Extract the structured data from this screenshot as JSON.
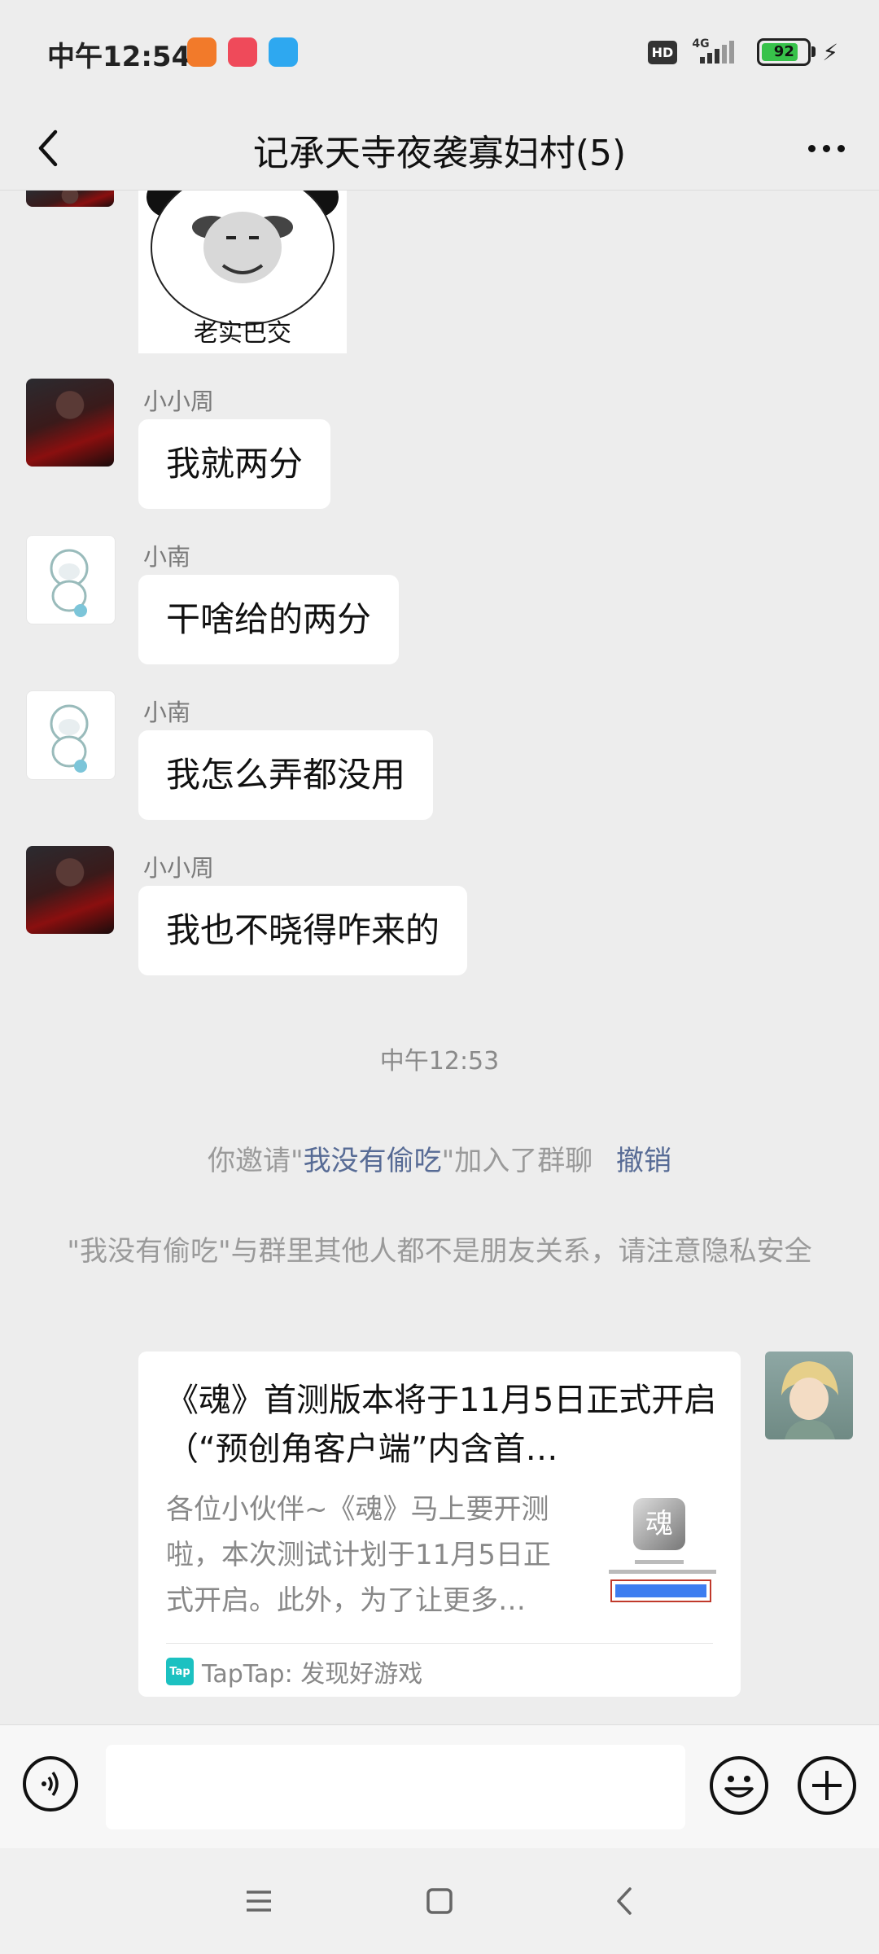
{
  "status_bar": {
    "time": "中午12:54",
    "hd": "HD",
    "network": "4G",
    "battery": "92",
    "battery_level": 0.92
  },
  "header": {
    "title": "记承天寺夜袭寡妇村(5)"
  },
  "messages": {
    "sticker_caption": "老实巴交",
    "m1": {
      "sender": "小小周",
      "text": "我就两分"
    },
    "m2": {
      "sender": "小南",
      "text": "干啥给的两分"
    },
    "m3": {
      "sender": "小南",
      "text": "我怎么弄都没用"
    },
    "m4": {
      "sender": "小小周",
      "text": "我也不晓得咋来的"
    }
  },
  "system": {
    "time": "中午12:53",
    "invite_prefix": "你邀请\"",
    "invite_name": "我没有偷吃",
    "invite_suffix": "\"加入了群聊",
    "undo": "撤销",
    "warning": "\"我没有偷吃\"与群里其他人都不是朋友关系，请注意隐私安全"
  },
  "card": {
    "title": "《魂》首测版本将于11月5日正式开启（“预创角客户端”内含首…",
    "desc": "各位小伙伴~《魂》马上要开测啦，本次测试计划于11月5日正式开启。此外，为了让更多…",
    "thumb_icon_text": "魂",
    "source_icon": "Tap",
    "source": "TapTap: 发现好游戏"
  },
  "input": {
    "placeholder": ""
  },
  "colors": {
    "background": "#ededed",
    "bubble": "#ffffff",
    "link": "#576b95",
    "taptap": "#1cc1c1",
    "battery": "#37c24a"
  },
  "icons": {
    "back": "chevron-left-icon",
    "more": "more-dots-icon",
    "voice": "voice-icon",
    "emoji": "emoji-icon",
    "plus": "plus-icon",
    "nav_menu": "menu-icon",
    "nav_home": "home-icon",
    "nav_back": "back-icon"
  }
}
